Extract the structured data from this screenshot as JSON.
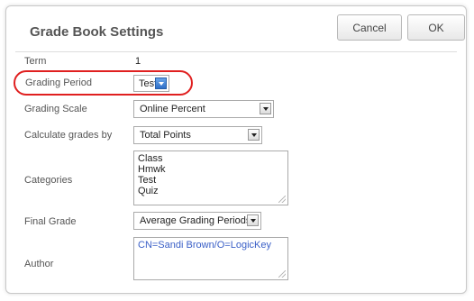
{
  "dialog": {
    "title": "Grade Book Settings",
    "cancel_label": "Cancel",
    "ok_label": "OK"
  },
  "fields": {
    "term": {
      "label": "Term",
      "value": "1"
    },
    "grading_period": {
      "label": "Grading Period",
      "value": "Test"
    },
    "grading_scale": {
      "label": "Grading Scale",
      "value": "Online Percent"
    },
    "calculate_grades_by": {
      "label": "Calculate grades by",
      "value": "Total Points"
    },
    "categories": {
      "label": "Categories",
      "items": [
        "Class",
        "Hmwk",
        "Test",
        "Quiz"
      ]
    },
    "final_grade": {
      "label": "Final Grade",
      "value": "Average Grading Periods"
    },
    "author": {
      "label": "Author",
      "value": "CN=Sandi Brown/O=LogicKey"
    }
  },
  "colors": {
    "highlight": "#e02020",
    "author_text": "#3a5fc7",
    "dropdown_active": "#2e6fc8"
  }
}
